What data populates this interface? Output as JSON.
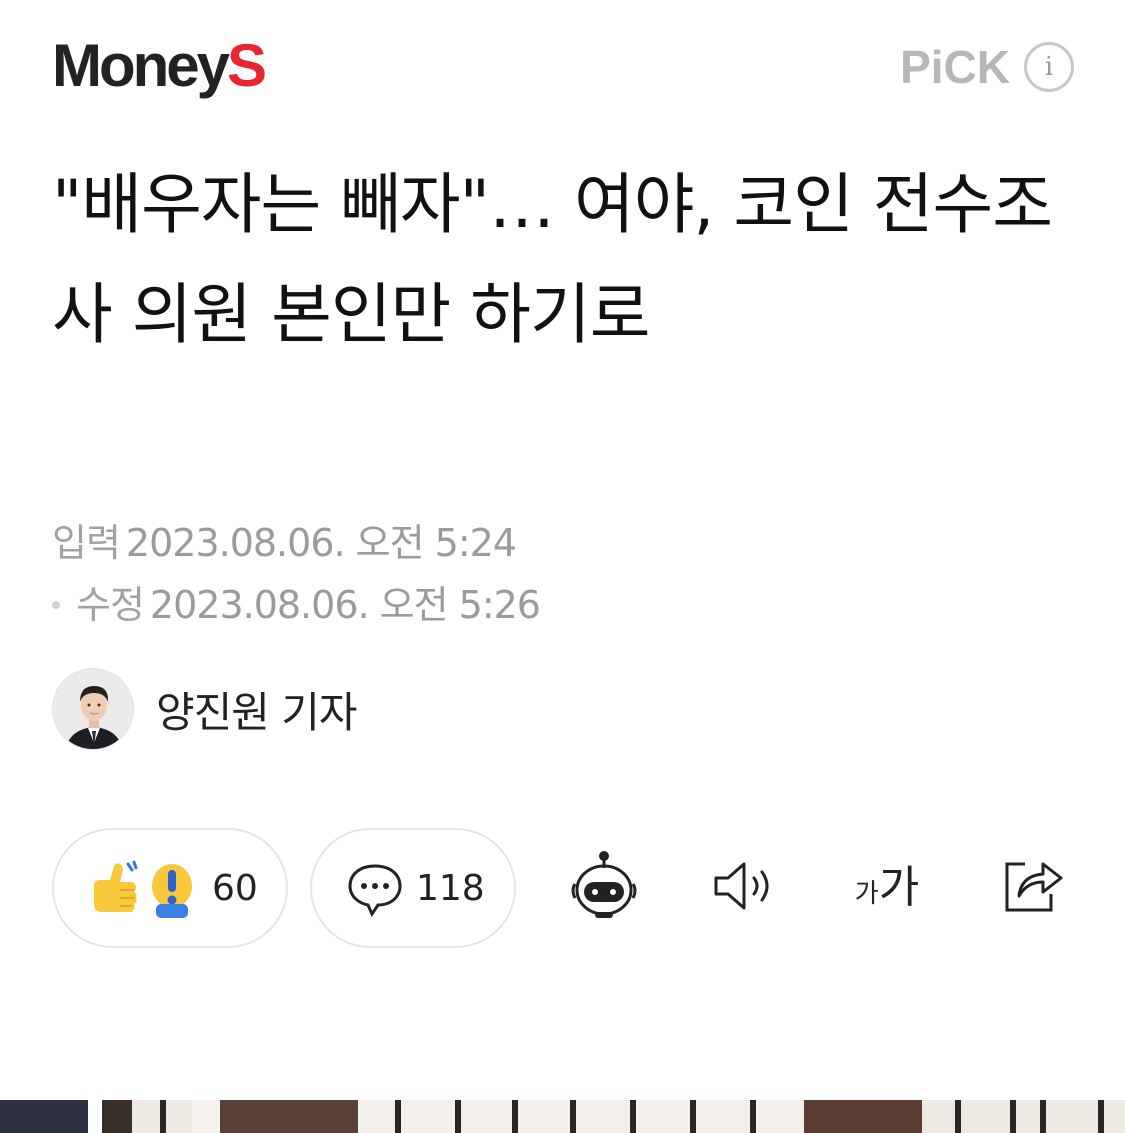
{
  "header": {
    "logo_main": "Money",
    "logo_accent": "S",
    "pick_label": "PiCK",
    "info_icon": "i"
  },
  "article": {
    "headline": "\"배우자는 빼자\"… 여야, 코인 전수조사 의원 본인만 하기로",
    "input_label": "입력",
    "input_date": "2023.08.06. 오전 5:24",
    "modified_label": "수정",
    "modified_date": "2023.08.06. 오전 5:26",
    "reporter": "양진원 기자"
  },
  "actions": {
    "reactions_count": "60",
    "comments_count": "118",
    "font_size_small": "가",
    "font_size_large": "가"
  },
  "icons": [
    "thumbs-up-icon",
    "exclamation-icon",
    "comment-icon",
    "robot-icon",
    "speaker-icon",
    "font-size-icon",
    "share-icon"
  ],
  "colors": {
    "brand_red": "#e8262e",
    "logo_dark": "#222222",
    "muted_gray": "#9b9b9b",
    "reaction_yellow": "#f6c83a",
    "reaction_blue": "#2f79e6"
  }
}
